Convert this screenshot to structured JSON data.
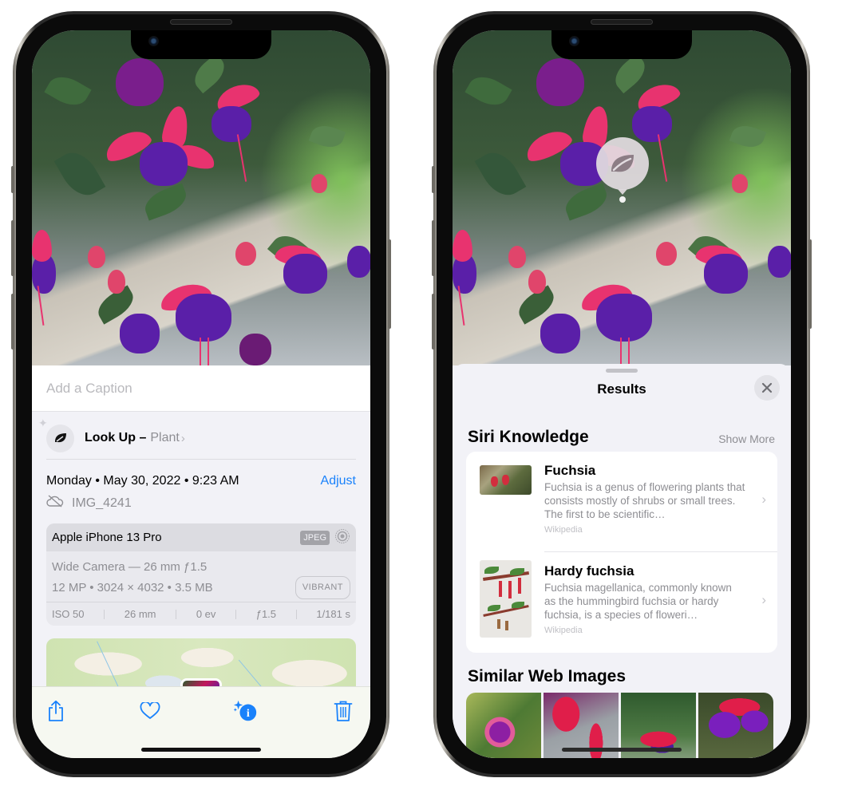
{
  "left_phone": {
    "caption_placeholder": "Add a Caption",
    "lookup": {
      "label": "Look Up –",
      "category": "Plant",
      "chevron": "›",
      "icon": "leaf-icon"
    },
    "date": "Monday • May 30, 2022 • 9:23 AM",
    "adjust_label": "Adjust",
    "filename": "IMG_4241",
    "file_icon": "cloud-slash-icon",
    "exif": {
      "device": "Apple iPhone 13 Pro",
      "format_badge": "JPEG",
      "lens": "Wide Camera — 26 mm ƒ1.5",
      "resolution": "12 MP • 3024 × 4032 • 3.5 MB",
      "style_badge": "VIBRANT",
      "specs": [
        "ISO 50",
        "26 mm",
        "0 ev",
        "ƒ1.5",
        "1/181 s"
      ]
    },
    "toolbar": [
      "share-icon",
      "heart-icon",
      "info-sparkle-icon",
      "trash-icon"
    ]
  },
  "right_phone": {
    "visual_lookup_icon": "leaf-icon",
    "sheet": {
      "title": "Results",
      "close_icon": "close-icon",
      "siri_knowledge_title": "Siri Knowledge",
      "show_more": "Show More",
      "results": [
        {
          "title": "Fuchsia",
          "description": "Fuchsia is a genus of flowering plants that consists mostly of shrubs or small trees. The first to be scientific…",
          "source": "Wikipedia"
        },
        {
          "title": "Hardy fuchsia",
          "description": "Fuchsia magellanica, commonly known as the hummingbird fuchsia or hardy fuchsia, is a species of floweri…",
          "source": "Wikipedia"
        }
      ],
      "similar_images_title": "Similar Web Images",
      "similar_images_count": 4
    }
  },
  "colors": {
    "accent": "#1a82fb",
    "secondary_text": "#8e8e93",
    "sheet_bg": "#f2f2f7"
  }
}
